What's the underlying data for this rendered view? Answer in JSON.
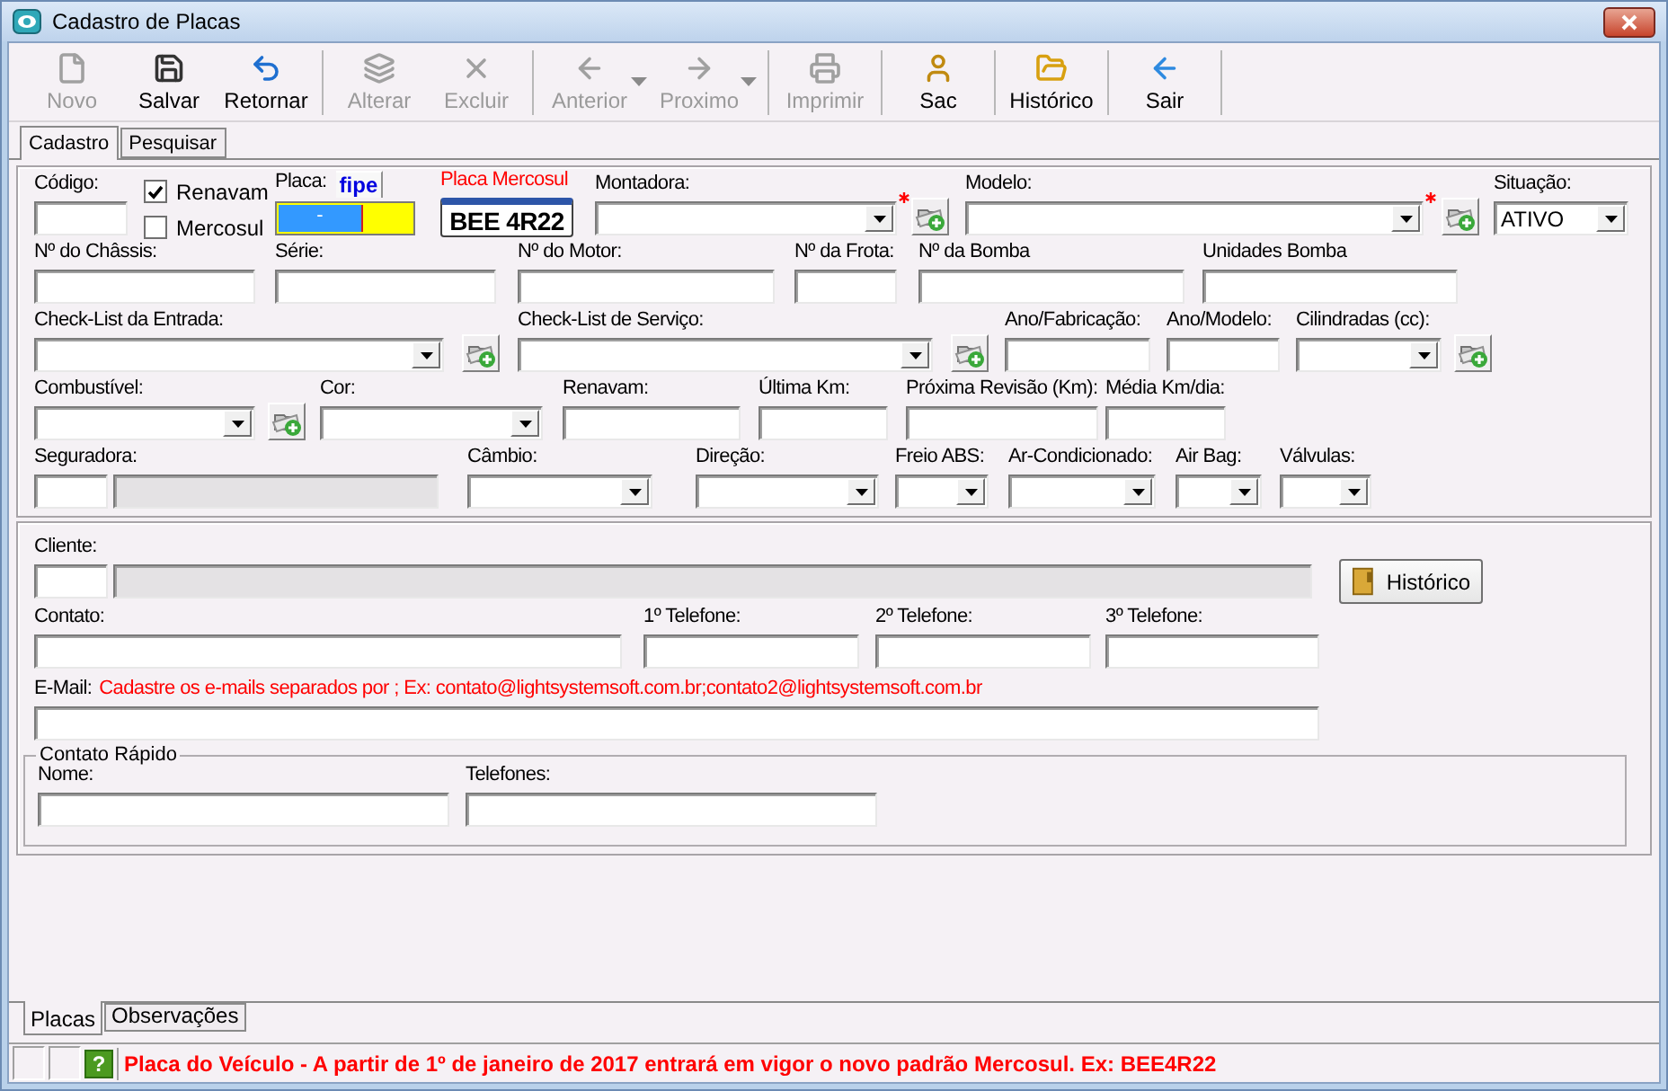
{
  "window": {
    "title": "Cadastro de Placas"
  },
  "toolbar": [
    {
      "buttons": [
        {
          "label": "Novo",
          "disabled": true,
          "menu": false
        },
        {
          "label": "Salvar",
          "disabled": false,
          "menu": false
        },
        {
          "label": "Retornar",
          "disabled": false,
          "menu": false
        }
      ]
    },
    {
      "buttons": [
        {
          "label": "Alterar",
          "disabled": true,
          "menu": false
        },
        {
          "label": "Excluir",
          "disabled": true,
          "menu": false
        }
      ]
    },
    {
      "buttons": [
        {
          "label": "Anterior",
          "disabled": true,
          "menu": true
        },
        {
          "label": "Proximo",
          "disabled": true,
          "menu": true
        }
      ]
    },
    {
      "buttons": [
        {
          "label": "Imprimir",
          "disabled": true,
          "menu": false
        }
      ]
    },
    {
      "buttons": [
        {
          "label": "Sac",
          "disabled": false,
          "menu": false
        }
      ]
    },
    {
      "buttons": [
        {
          "label": "Histórico",
          "disabled": false,
          "menu": false
        }
      ]
    },
    {
      "buttons": [
        {
          "label": "Sair",
          "disabled": false,
          "menu": false
        }
      ]
    }
  ],
  "tabs": [
    {
      "label": "Cadastro",
      "selected": true
    },
    {
      "label": "Pesquisar",
      "selected": false
    }
  ],
  "vehicle_rows": [
    [
      {
        "kind": "text",
        "label": "Código:"
      },
      {
        "kind": "checks",
        "options": [
          {
            "label": "Renavam",
            "checked": true
          },
          {
            "label": "Mercosul",
            "checked": false
          }
        ]
      },
      {
        "kind": "plate_input",
        "label": "Placa:",
        "tag": "fipe",
        "value": "-"
      },
      {
        "kind": "plate_image",
        "label": "Placa Mercosul",
        "plate": "BEE 4R22"
      },
      {
        "kind": "combo",
        "label": "Montadora:",
        "required": true,
        "add_button": true
      },
      {
        "kind": "combo",
        "label": "Modelo:",
        "required": true,
        "add_button": true
      },
      {
        "kind": "combo",
        "label": "Situação:",
        "value": "ATIVO",
        "required": false,
        "add_button": false
      }
    ],
    [
      {
        "kind": "text",
        "label": "Nº do Châssis:"
      },
      {
        "kind": "text",
        "label": "Série:"
      },
      {
        "kind": "text",
        "label": "Nº do Motor:"
      },
      {
        "kind": "text",
        "label": "Nº da Frota:"
      },
      {
        "kind": "text",
        "label": "Nº da Bomba"
      },
      {
        "kind": "text",
        "label": "Unidades Bomba"
      }
    ],
    [
      {
        "kind": "combo",
        "label": "Check-List da Entrada:",
        "required": false,
        "add_button": true
      },
      {
        "kind": "combo",
        "label": "Check-List de Serviço:",
        "required": false,
        "add_button": true
      },
      {
        "kind": "text",
        "label": "Ano/Fabricação:"
      },
      {
        "kind": "text",
        "label": "Ano/Modelo:"
      },
      {
        "kind": "combo",
        "label": "Cilindradas (cc):",
        "required": false,
        "add_button": true
      }
    ],
    [
      {
        "kind": "combo",
        "label": "Combustível:",
        "required": false,
        "add_button": true
      },
      {
        "kind": "combo",
        "label": "Cor:",
        "required": false,
        "add_button": false
      },
      {
        "kind": "text",
        "label": "Renavam:"
      },
      {
        "kind": "text",
        "label": "Última Km:"
      },
      {
        "kind": "text",
        "label": "Próxima Revisão (Km):"
      },
      {
        "kind": "text",
        "label": "Média Km/dia:"
      }
    ],
    [
      {
        "kind": "lookup",
        "label": "Seguradora:"
      },
      {
        "kind": "combo",
        "label": "Câmbio:",
        "required": false,
        "add_button": false
      },
      {
        "kind": "combo",
        "label": "Direção:",
        "required": false,
        "add_button": false
      },
      {
        "kind": "combo",
        "label": "Freio ABS:",
        "required": false,
        "add_button": false
      },
      {
        "kind": "combo",
        "label": "Ar-Condicionado:",
        "required": false,
        "add_button": false
      },
      {
        "kind": "combo",
        "label": "Air Bag:",
        "required": false,
        "add_button": false
      },
      {
        "kind": "combo",
        "label": "Válvulas:",
        "required": false,
        "add_button": false
      }
    ]
  ],
  "client": {
    "label": "Cliente:",
    "button": "Histórico"
  },
  "contact_row": [
    {
      "label": "Contato:"
    },
    {
      "label": "1º Telefone:"
    },
    {
      "label": "2º Telefone:"
    },
    {
      "label": "3º Telefone:"
    }
  ],
  "email": {
    "label": "E-Mail:",
    "hint": "Cadastre os e-mails separados por ; Ex: contato@lightsystemsoft.com.br;contato2@lightsystemsoft.com.br"
  },
  "quick_contact": {
    "title": "Contato Rápido",
    "fields": [
      {
        "label": "Nome:"
      },
      {
        "label": "Telefones:"
      }
    ]
  },
  "bottom_tabs": [
    {
      "label": "Placas",
      "selected": true
    },
    {
      "label": "Observações",
      "selected": false
    }
  ],
  "status_bar": {
    "help": "?",
    "message": "Placa do Veículo - A partir de 1º de janeiro de 2017 entrará em vigor o novo padrão Mercosul. Ex: BEE4R22"
  }
}
